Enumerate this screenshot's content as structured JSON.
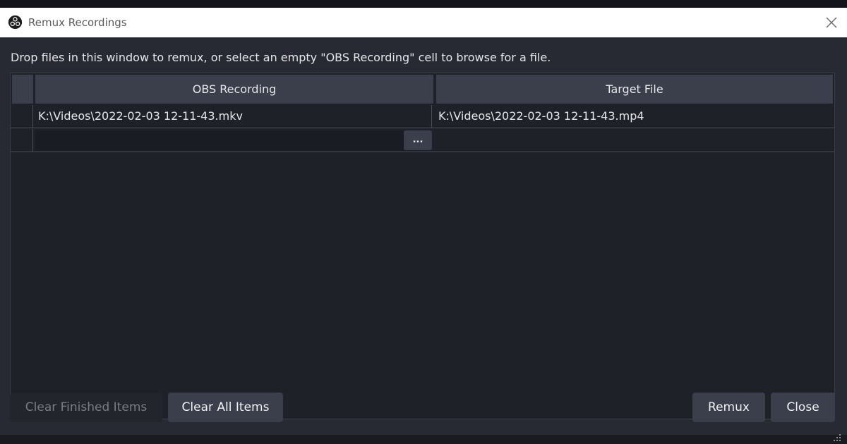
{
  "window": {
    "title": "Remux Recordings",
    "app_icon": "obs-logo-icon",
    "close_icon": "close-icon"
  },
  "instructions": "Drop files in this window to remux, or select an empty \"OBS Recording\" cell to browse for a file.",
  "table": {
    "columns": [
      "OBS Recording",
      "Target File"
    ],
    "rows": [
      {
        "obs_recording": "K:\\Videos\\2022-02-03 12-11-43.mkv",
        "target_file": "K:\\Videos\\2022-02-03 12-11-43.mp4"
      },
      {
        "obs_recording": "",
        "target_file": "",
        "browse_label": "..."
      }
    ]
  },
  "buttons": {
    "clear_finished": "Clear Finished Items",
    "clear_all": "Clear All Items",
    "remux": "Remux",
    "close": "Close"
  },
  "colors": {
    "background": "#272a33",
    "header_bg": "#3b3f4b",
    "button_bg": "#3b3f4b",
    "text": "#e6e7ea",
    "disabled_text": "#7a7c85"
  }
}
